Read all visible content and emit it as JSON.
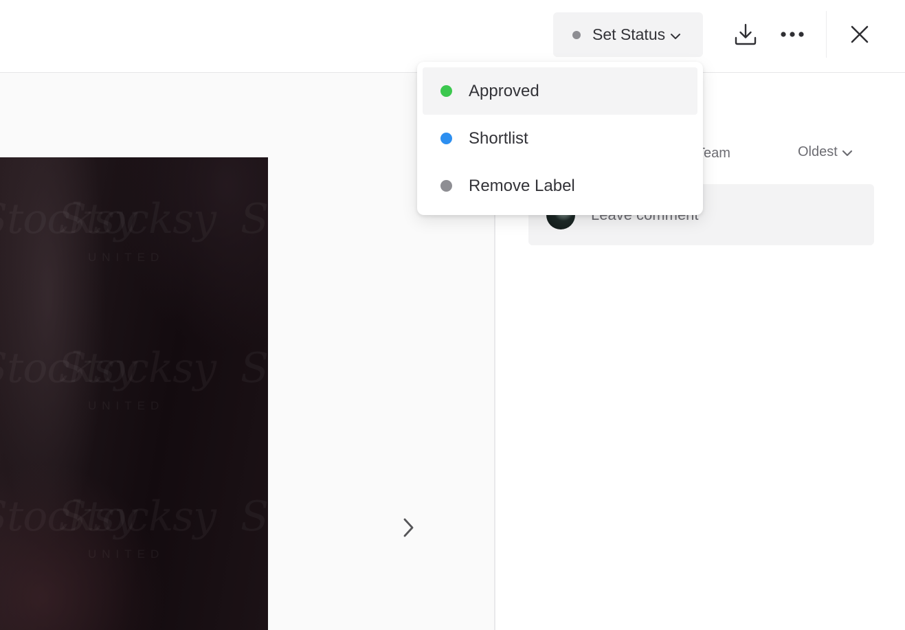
{
  "header": {
    "status_button_label": "Set Status",
    "status_dot_color": "#8e8e93"
  },
  "status_menu": {
    "items": [
      {
        "label": "Approved",
        "color": "#3cc84f",
        "active": true
      },
      {
        "label": "Shortlist",
        "color": "#2d8ff0",
        "active": false
      },
      {
        "label": "Remove Label",
        "color": "#8e8e93",
        "active": false
      }
    ]
  },
  "viewer": {
    "watermark_text": "Stocksy",
    "watermark_subtext": "UNITED"
  },
  "comments": {
    "filter_label": "Team",
    "sort_label": "Oldest",
    "input_placeholder": "Leave comment"
  },
  "icons": {
    "download": "download-icon",
    "more": "more-horizontal-icon",
    "close": "close-icon",
    "next": "chevron-right-icon",
    "status_chevron": "chevron-down-icon"
  }
}
